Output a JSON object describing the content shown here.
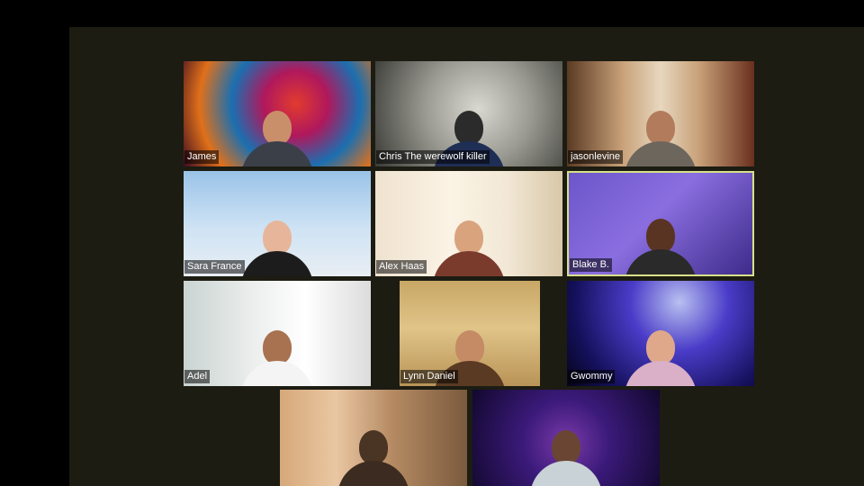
{
  "gallery": {
    "participants": [
      {
        "name": "James"
      },
      {
        "name": "Chris The werewolf killer"
      },
      {
        "name": "jasonlevine"
      },
      {
        "name": "Sara France"
      },
      {
        "name": "Alex Haas"
      },
      {
        "name": "Blake B.",
        "active_speaker": true
      },
      {
        "name": "Adel"
      },
      {
        "name": "Lynn Daniel"
      },
      {
        "name": "Gwommy"
      },
      {
        "name": ""
      },
      {
        "name": ""
      }
    ],
    "active_border_color": "#d8e089"
  }
}
